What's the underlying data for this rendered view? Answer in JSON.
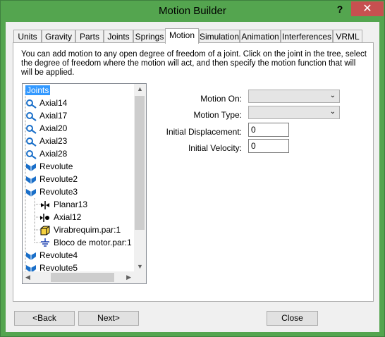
{
  "window": {
    "title": "Motion Builder",
    "help_label": "?",
    "close_label": "✕"
  },
  "tabs": [
    {
      "label": "Units"
    },
    {
      "label": "Gravity"
    },
    {
      "label": "Parts"
    },
    {
      "label": "Joints"
    },
    {
      "label": "Springs"
    },
    {
      "label": "Motion"
    },
    {
      "label": "Simulation"
    },
    {
      "label": "Animation"
    },
    {
      "label": "Interferences"
    },
    {
      "label": "VRML"
    }
  ],
  "active_tab": "Motion",
  "description": "You can add motion to any open degree of freedom of a joint. Click on the joint in the tree, select the degree of freedom where the motion will act, and then specify the motion function that will will be applied.",
  "tree": [
    {
      "label": "Joints",
      "icon": "joints-root",
      "selected": true
    },
    {
      "label": "Axial14",
      "icon": "axial-joint-icon"
    },
    {
      "label": "Axial17",
      "icon": "axial-joint-icon"
    },
    {
      "label": "Axial20",
      "icon": "axial-joint-icon"
    },
    {
      "label": "Axial23",
      "icon": "axial-joint-icon"
    },
    {
      "label": "Axial28",
      "icon": "axial-joint-icon"
    },
    {
      "label": "Revolute",
      "icon": "revolute-joint-icon"
    },
    {
      "label": "Revolute2",
      "icon": "revolute-joint-icon"
    },
    {
      "label": "Revolute3",
      "icon": "revolute-joint-icon"
    },
    {
      "label": "Planar13",
      "icon": "planar-constraint-icon"
    },
    {
      "label": "Axial12",
      "icon": "axial-constraint-icon"
    },
    {
      "label": "Virabrequim.par:1",
      "icon": "part-icon"
    },
    {
      "label": "Bloco de motor.par:1",
      "icon": "ground-icon"
    },
    {
      "label": "Revolute4",
      "icon": "revolute-joint-icon"
    },
    {
      "label": "Revolute5",
      "icon": "revolute-joint-icon"
    }
  ],
  "form": {
    "motion_on_label": "Motion On:",
    "motion_on_value": "",
    "motion_type_label": "Motion Type:",
    "motion_type_value": "",
    "initial_displacement_label": "Initial Displacement:",
    "initial_displacement_value": "0",
    "initial_velocity_label": "Initial Velocity:",
    "initial_velocity_value": "0"
  },
  "buttons": {
    "back": "<Back",
    "next": "Next>",
    "close": "Close"
  },
  "colors": {
    "frame": "#54a54f",
    "close_button": "#c75050",
    "selection": "#3399ff"
  }
}
